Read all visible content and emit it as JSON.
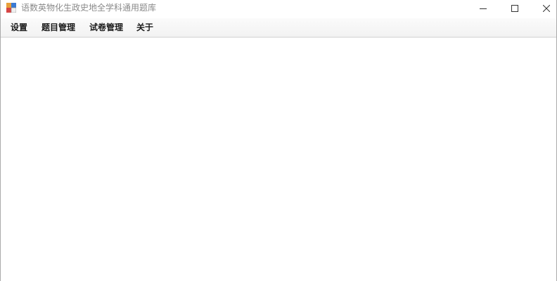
{
  "window": {
    "title": "语数英物化生政史地全学科通用题库",
    "app_icon": "application-icon",
    "controls": {
      "minimize_icon": "minimize-icon",
      "maximize_icon": "maximize-icon",
      "close_icon": "close-icon"
    }
  },
  "menu": {
    "items": [
      {
        "label": "设置"
      },
      {
        "label": "题目管理"
      },
      {
        "label": "试卷管理"
      },
      {
        "label": "关于"
      }
    ]
  },
  "colors": {
    "title_text": "#8a8a8a",
    "menu_bg": "#f2f2f2",
    "client_bg": "#ffffff"
  }
}
